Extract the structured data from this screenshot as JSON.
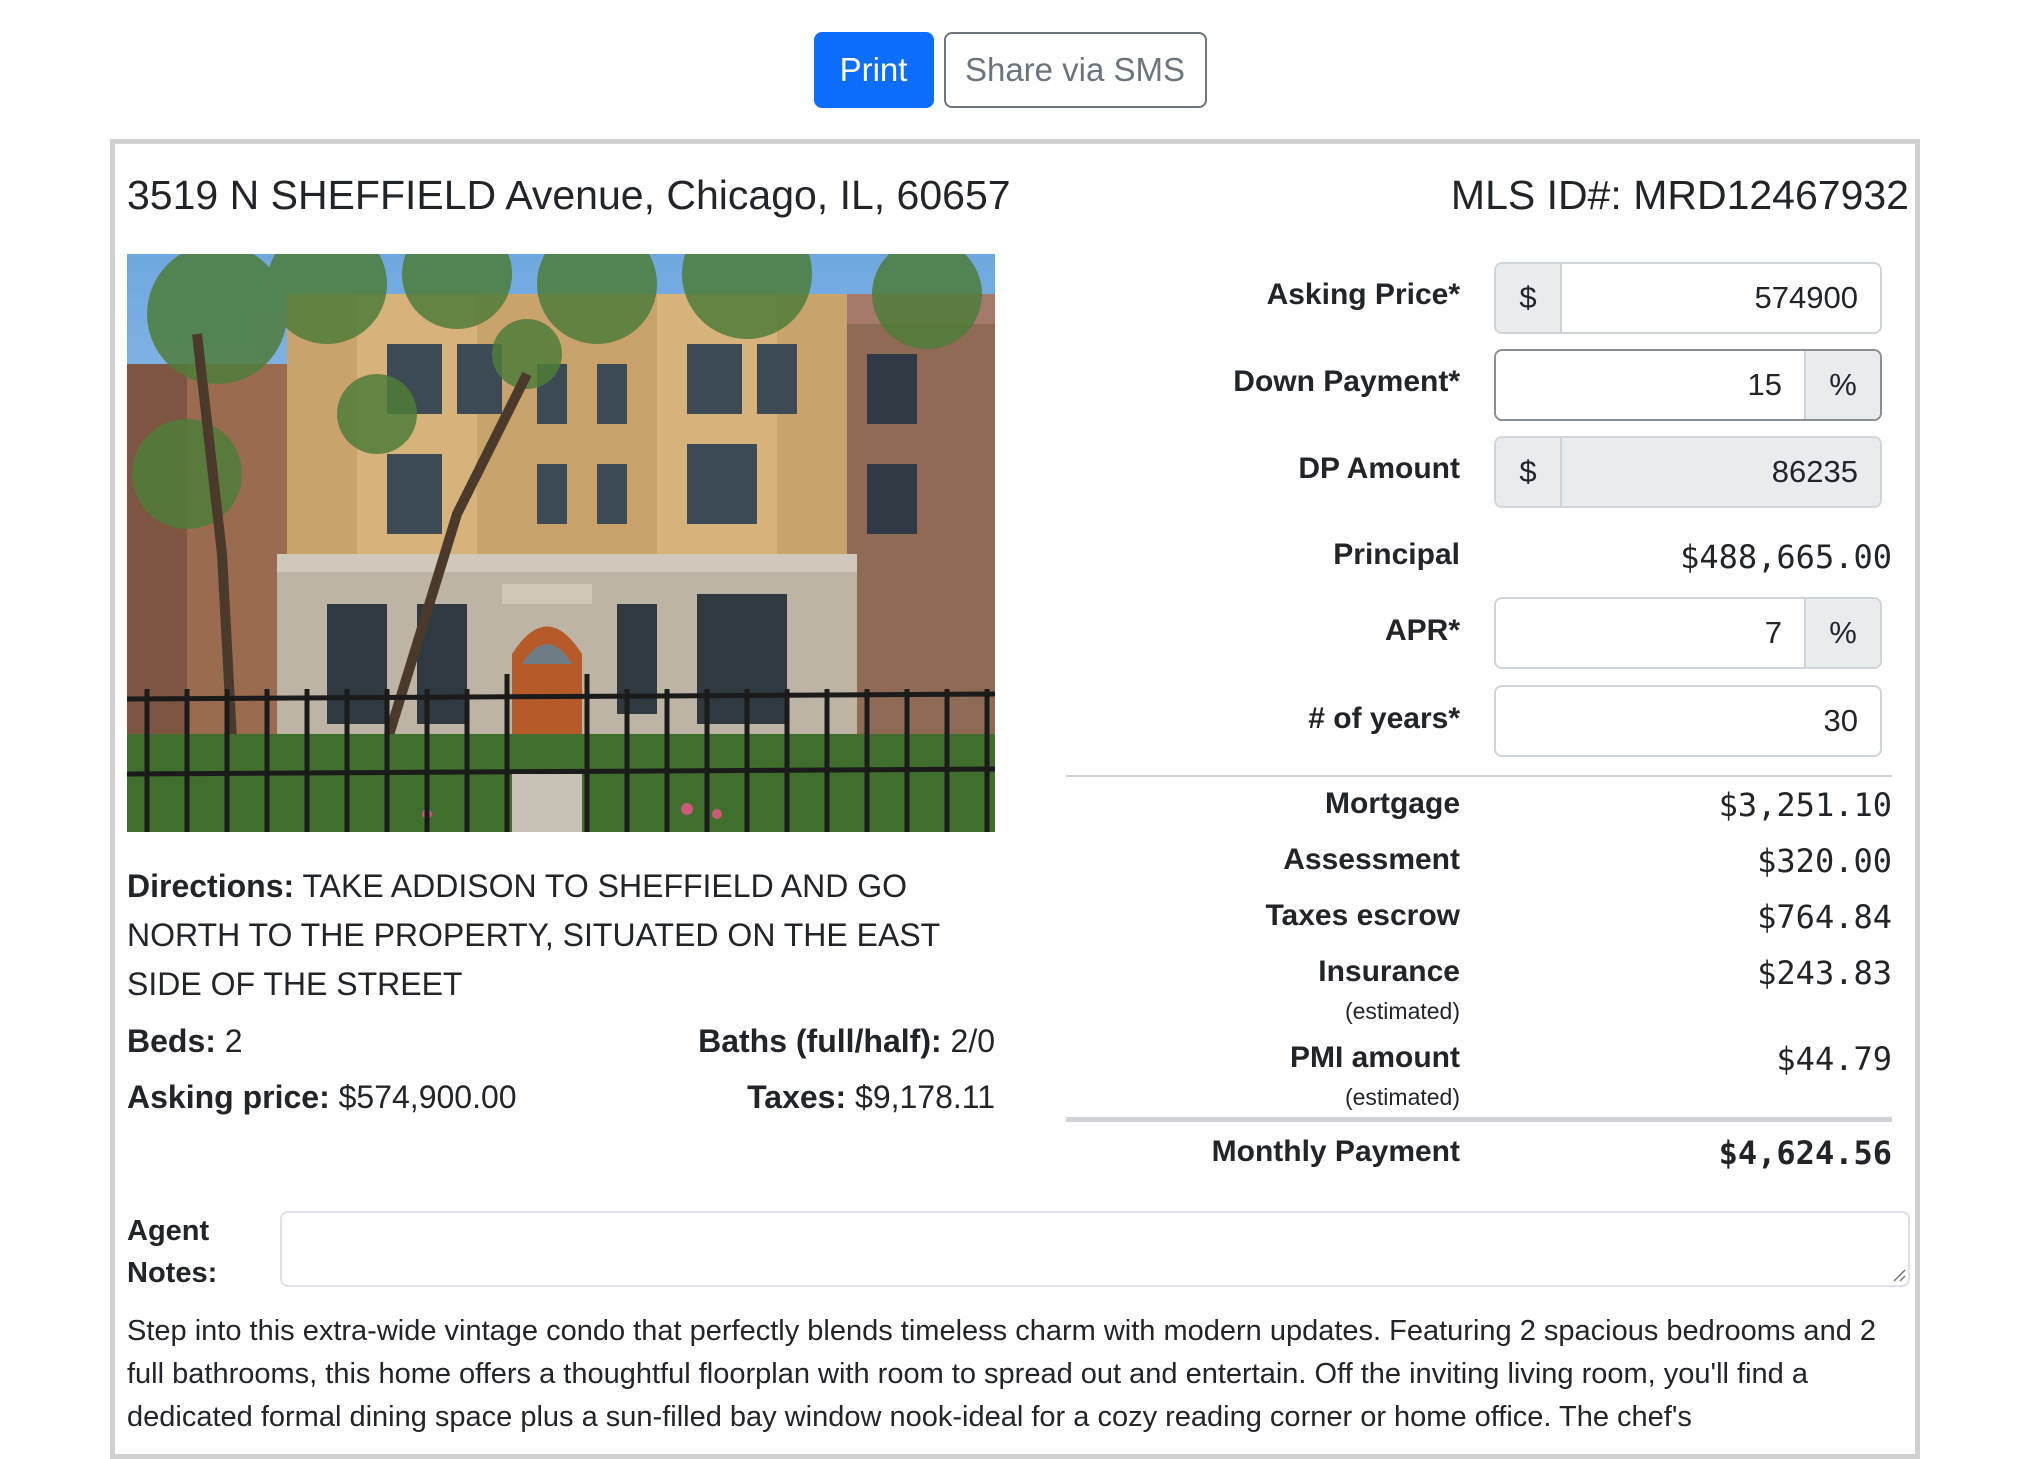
{
  "toolbar": {
    "print_label": "Print",
    "share_label": "Share via SMS"
  },
  "listing": {
    "address": "3519 N SHEFFIELD Avenue, Chicago, IL, 60657",
    "mls": "MLS ID#: MRD12467932",
    "photo_icon": "building-photo",
    "directions_label": "Directions:",
    "directions_text": "TAKE ADDISON TO SHEFFIELD AND GO NORTH TO THE PROPERTY, SITUATED ON THE EAST SIDE OF THE STREET",
    "beds_label": "Beds:",
    "beds_value": "2",
    "baths_label": "Baths (full/half):",
    "baths_value": "2/0",
    "asking_label": "Asking price:",
    "asking_value": "$574,900.00",
    "taxes_label": "Taxes:",
    "taxes_value": "$9,178.11"
  },
  "calculator": {
    "asking_price": {
      "label": "Asking Price*",
      "prefix": "$",
      "value": "574900"
    },
    "down_payment": {
      "label": "Down Payment*",
      "value": "15",
      "suffix": "%"
    },
    "dp_amount": {
      "label": "DP Amount",
      "prefix": "$",
      "value": "86235"
    },
    "principal": {
      "label": "Principal",
      "value": "$488,665.00"
    },
    "apr": {
      "label": "APR*",
      "value": "7",
      "suffix": "%"
    },
    "years": {
      "label": "# of years*",
      "value": "30"
    },
    "mortgage": {
      "label": "Mortgage",
      "value": "$3,251.10"
    },
    "assessment": {
      "label": "Assessment",
      "value": "$320.00"
    },
    "taxes_escrow": {
      "label": "Taxes escrow",
      "value": "$764.84"
    },
    "insurance": {
      "label": "Insurance",
      "sub": "(estimated)",
      "value": "$243.83"
    },
    "pmi": {
      "label": "PMI amount",
      "sub": "(estimated)",
      "value": "$44.79"
    },
    "monthly": {
      "label": "Monthly Payment",
      "value": "$4,624.56"
    }
  },
  "notes": {
    "label": "Agent Notes:",
    "value": ""
  },
  "description": "Step into this extra-wide vintage condo that perfectly blends timeless charm with modern updates. Featuring 2 spacious bedrooms and 2 full bathrooms, this home offers a thoughtful floorplan with room to spread out and entertain. Off the inviting living room, you'll find a dedicated formal dining space plus a sun-filled bay window nook-ideal for a cozy reading corner or home office. The chef's",
  "colors": {
    "primary": "#0d6efd",
    "secondary": "#6c757d",
    "addon_bg": "#e9ecef"
  }
}
